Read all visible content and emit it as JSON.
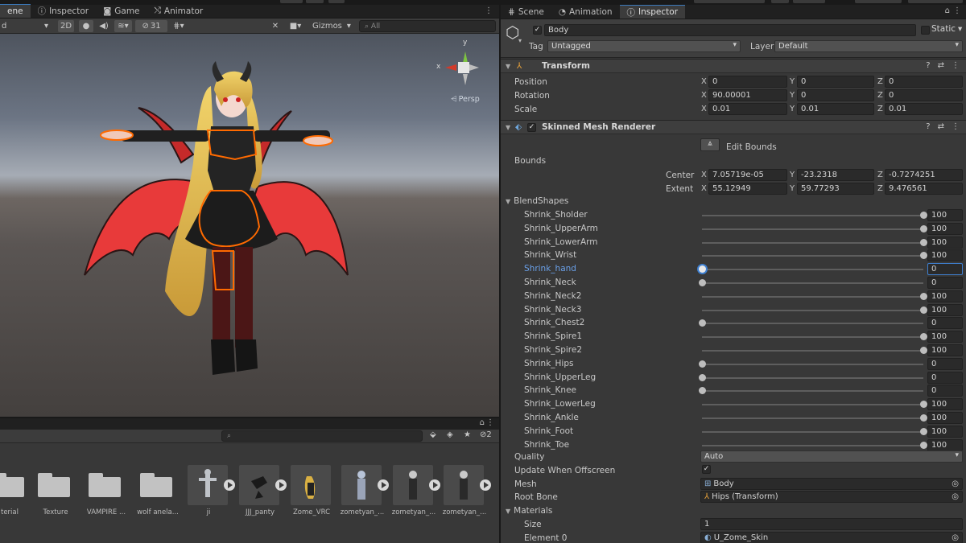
{
  "scene_window": {
    "tabs": [
      "ene",
      "Inspector",
      "Game",
      "Animator"
    ],
    "toolbar": {
      "draw_mode": "d",
      "mode_2d": "2D",
      "hidden_count": "31",
      "gizmos": "Gizmos",
      "search_placeholder": "All"
    },
    "gizmo": {
      "y_label": "y",
      "x_label": "x",
      "projection": "Persp"
    }
  },
  "project_window": {
    "hidden_count": "2",
    "assets": [
      {
        "label": "terial",
        "kind": "folder"
      },
      {
        "label": "Texture",
        "kind": "folder"
      },
      {
        "label": "VAMPIRE ...",
        "kind": "folder"
      },
      {
        "label": "wolf anela...",
        "kind": "folder"
      },
      {
        "label": "ji",
        "kind": "model"
      },
      {
        "label": "JJJ_panty",
        "kind": "model"
      },
      {
        "label": "Zome_VRC",
        "kind": "model"
      },
      {
        "label": "zometyan_...",
        "kind": "model"
      },
      {
        "label": "zometyan_...",
        "kind": "model"
      },
      {
        "label": "zometyan_...",
        "kind": "model"
      }
    ]
  },
  "inspector_window": {
    "tabs": [
      "Scene",
      "Animation",
      "Inspector"
    ],
    "object": {
      "name": "Body",
      "static_label": "Static",
      "tag_label": "Tag",
      "tag_value": "Untagged",
      "layer_label": "Layer",
      "layer_value": "Default"
    },
    "transform": {
      "title": "Transform",
      "rows": [
        {
          "label": "Position",
          "x": "0",
          "y": "0",
          "z": "0"
        },
        {
          "label": "Rotation",
          "x": "90.00001",
          "y": "0",
          "z": "0"
        },
        {
          "label": "Scale",
          "x": "0.01",
          "y": "0.01",
          "z": "0.01"
        }
      ]
    },
    "skinned_mesh": {
      "title": "Skinned Mesh Renderer",
      "edit_bounds": "Edit Bounds",
      "bounds_label": "Bounds",
      "center": {
        "label": "Center",
        "x": "7.05719e-05",
        "y": "-23.2318",
        "z": "-0.7274251"
      },
      "extent": {
        "label": "Extent",
        "x": "55.12949",
        "y": "59.77293",
        "z": "9.476561"
      },
      "blendshapes_label": "BlendShapes",
      "blendshapes": [
        {
          "name": "Shrink_Sholder",
          "value": 100
        },
        {
          "name": "Shrink_UpperArm",
          "value": 100
        },
        {
          "name": "Shrink_LowerArm",
          "value": 100
        },
        {
          "name": "Shrink_Wrist",
          "value": 100
        },
        {
          "name": "Shrink_hand",
          "value": 0
        },
        {
          "name": "Shrink_Neck",
          "value": 0
        },
        {
          "name": "Shrink_Neck2",
          "value": 100
        },
        {
          "name": "Shrink_Neck3",
          "value": 100
        },
        {
          "name": "Shrink_Chest2",
          "value": 0
        },
        {
          "name": "Shrink_Spire1",
          "value": 100
        },
        {
          "name": "Shrink_Spire2",
          "value": 100
        },
        {
          "name": "Shrink_Hips",
          "value": 0
        },
        {
          "name": "Shrink_UpperLeg",
          "value": 0
        },
        {
          "name": "Shrink_Knee",
          "value": 0
        },
        {
          "name": "Shrink_LowerLeg",
          "value": 100
        },
        {
          "name": "Shrink_Ankle",
          "value": 100
        },
        {
          "name": "Shrink_Foot",
          "value": 100
        },
        {
          "name": "Shrink_Toe",
          "value": 100
        }
      ],
      "quality_label": "Quality",
      "quality_value": "Auto",
      "update_offscreen_label": "Update When Offscreen",
      "mesh_label": "Mesh",
      "mesh_value": "Body",
      "root_bone_label": "Root Bone",
      "root_bone_value": "Hips (Transform)",
      "materials_label": "Materials",
      "size_label": "Size",
      "size_value": "1",
      "element0_label": "Element 0",
      "element0_value": "U_Zome_Skin"
    }
  },
  "colors": {
    "selected_blue": "#3e7fd0",
    "outline_orange": "#ff6a00",
    "wing_red": "#e83a3a",
    "hair_blonde": "#e8c85a"
  }
}
